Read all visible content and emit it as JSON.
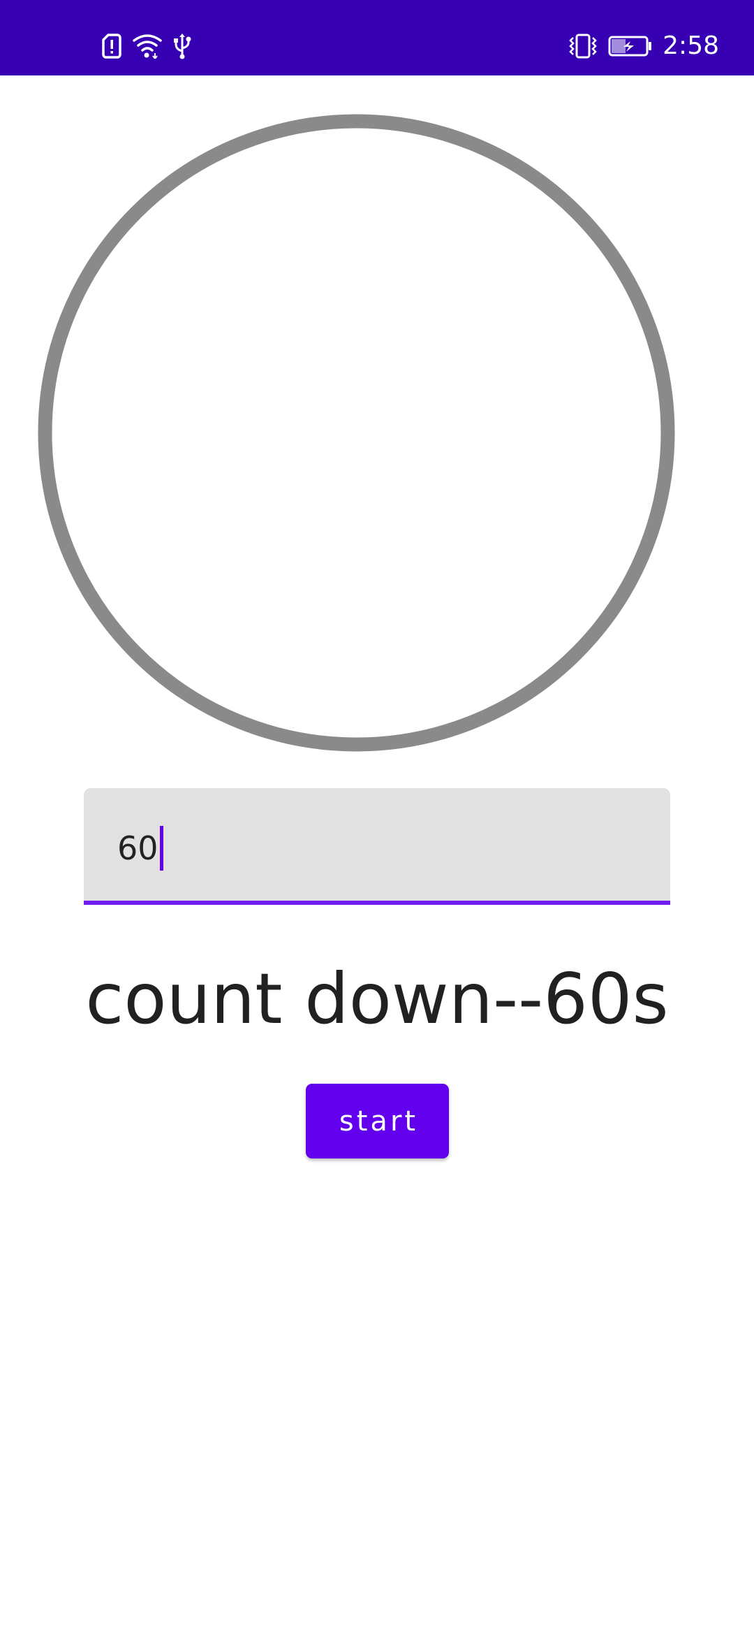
{
  "status_bar": {
    "time": "2:58",
    "background_color": "#3700b3",
    "left_icons": [
      "sim-alert-icon",
      "wifi-icon",
      "usb-icon"
    ],
    "right_icons": [
      "vibrate-icon",
      "battery-charging-icon"
    ]
  },
  "timer": {
    "ring_color": "#8a8a8a",
    "progress": 0
  },
  "input": {
    "value": "60",
    "underline_color": "#6f1cef",
    "background_color": "#e1e1e1"
  },
  "countdown": {
    "label": "count down--60s"
  },
  "start_button": {
    "label": "start",
    "color": "#6200ee"
  }
}
